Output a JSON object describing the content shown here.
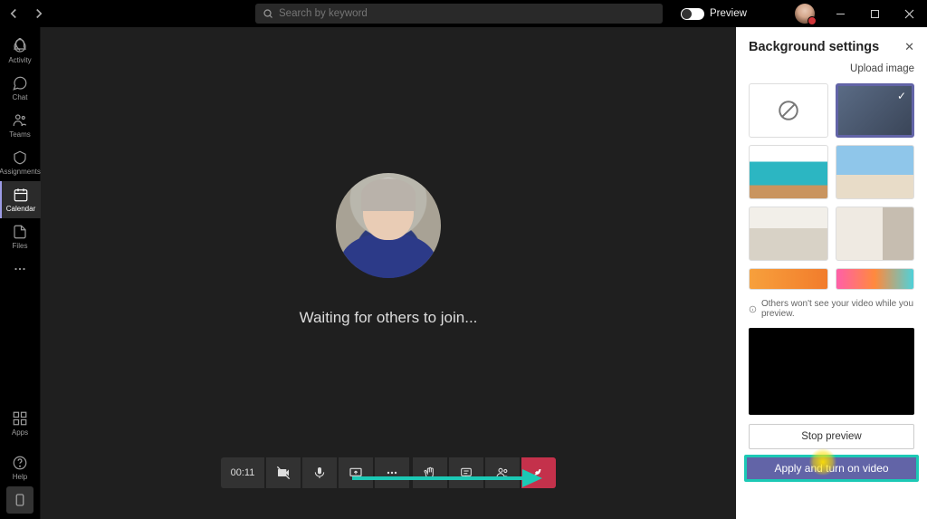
{
  "titlebar": {
    "search_placeholder": "Search by keyword",
    "preview_label": "Preview"
  },
  "rail": {
    "items": [
      {
        "label": "Activity"
      },
      {
        "label": "Chat"
      },
      {
        "label": "Teams"
      },
      {
        "label": "Assignments"
      },
      {
        "label": "Calendar"
      },
      {
        "label": "Files"
      }
    ],
    "apps_label": "Apps",
    "help_label": "Help"
  },
  "call": {
    "waiting_text": "Waiting for others to join...",
    "timer": "00:11"
  },
  "panel": {
    "title": "Background settings",
    "upload_link": "Upload image",
    "note_text": "Others won't see your video while you preview.",
    "stop_btn": "Stop preview",
    "apply_btn": "Apply and turn on video"
  }
}
